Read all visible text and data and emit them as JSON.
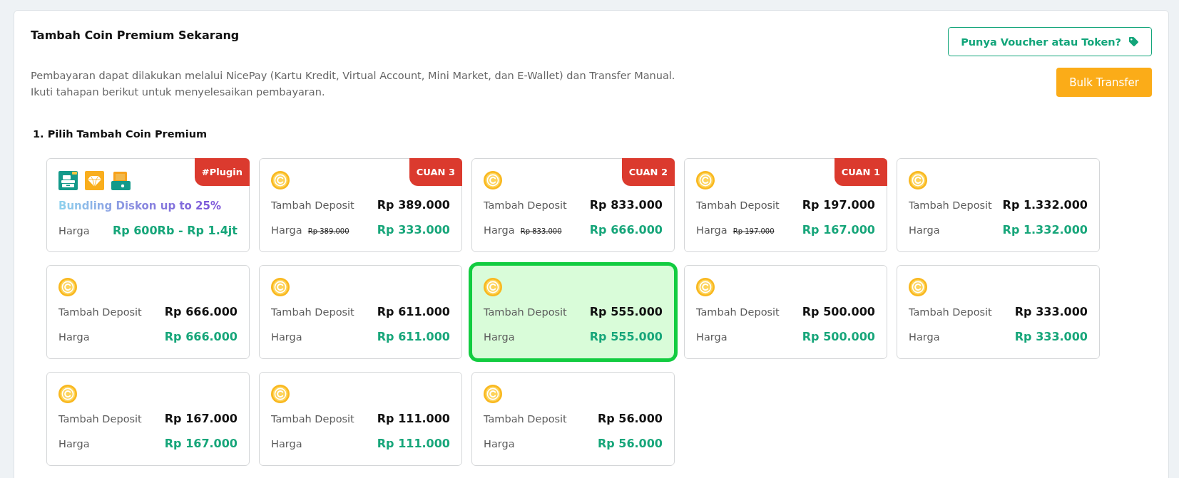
{
  "header": {
    "title": "Tambah Coin Premium Sekarang",
    "description_lines": [
      "Pembayaran dapat dilakukan melalui NicePay (Kartu Kredit, Virtual Account, Mini Market, dan E-Wallet) dan Transfer Manual.",
      "Ikuti tahapan berikut untuk menyelesaikan pembayaran."
    ]
  },
  "voucher_button": {
    "label": "Punya Voucher atau Token?"
  },
  "bulk_transfer_button": {
    "label": "Bulk Transfer"
  },
  "step": {
    "title": "1. Pilih Tambah Coin Premium"
  },
  "packages": [
    {
      "kind": "bundle",
      "badge": "#Plugin",
      "headline": "Bundling Diskon up to 25%",
      "price_label": "Harga",
      "price": "Rp 600Rb - Rp 1.4jt",
      "selected": false
    },
    {
      "kind": "deposit",
      "badge": "CUAN 3",
      "deposit_label": "Tambah Deposit",
      "deposit": "Rp 389.000",
      "price_label": "Harga",
      "original_price": "Rp 389.000",
      "price": "Rp 333.000",
      "selected": false
    },
    {
      "kind": "deposit",
      "badge": "CUAN 2",
      "deposit_label": "Tambah Deposit",
      "deposit": "Rp 833.000",
      "price_label": "Harga",
      "original_price": "Rp 833.000",
      "price": "Rp 666.000",
      "selected": false
    },
    {
      "kind": "deposit",
      "badge": "CUAN 1",
      "deposit_label": "Tambah Deposit",
      "deposit": "Rp 197.000",
      "price_label": "Harga",
      "original_price": "Rp 197.000",
      "price": "Rp 167.000",
      "selected": false
    },
    {
      "kind": "deposit",
      "deposit_label": "Tambah Deposit",
      "deposit": "Rp 1.332.000",
      "price_label": "Harga",
      "price": "Rp 1.332.000",
      "selected": false
    },
    {
      "kind": "deposit",
      "deposit_label": "Tambah Deposit",
      "deposit": "Rp 666.000",
      "price_label": "Harga",
      "price": "Rp 666.000",
      "selected": false
    },
    {
      "kind": "deposit",
      "deposit_label": "Tambah Deposit",
      "deposit": "Rp 611.000",
      "price_label": "Harga",
      "price": "Rp 611.000",
      "selected": false
    },
    {
      "kind": "deposit",
      "deposit_label": "Tambah Deposit",
      "deposit": "Rp 555.000",
      "price_label": "Harga",
      "price": "Rp 555.000",
      "selected": true
    },
    {
      "kind": "deposit",
      "deposit_label": "Tambah Deposit",
      "deposit": "Rp 500.000",
      "price_label": "Harga",
      "price": "Rp 500.000",
      "selected": false
    },
    {
      "kind": "deposit",
      "deposit_label": "Tambah Deposit",
      "deposit": "Rp 333.000",
      "price_label": "Harga",
      "price": "Rp 333.000",
      "selected": false
    },
    {
      "kind": "deposit",
      "deposit_label": "Tambah Deposit",
      "deposit": "Rp 167.000",
      "price_label": "Harga",
      "price": "Rp 167.000",
      "selected": false
    },
    {
      "kind": "deposit",
      "deposit_label": "Tambah Deposit",
      "deposit": "Rp 111.000",
      "price_label": "Harga",
      "price": "Rp 111.000",
      "selected": false
    },
    {
      "kind": "deposit",
      "deposit_label": "Tambah Deposit",
      "deposit": "Rp 56.000",
      "price_label": "Harga",
      "price": "Rp 56.000",
      "selected": false
    }
  ]
}
